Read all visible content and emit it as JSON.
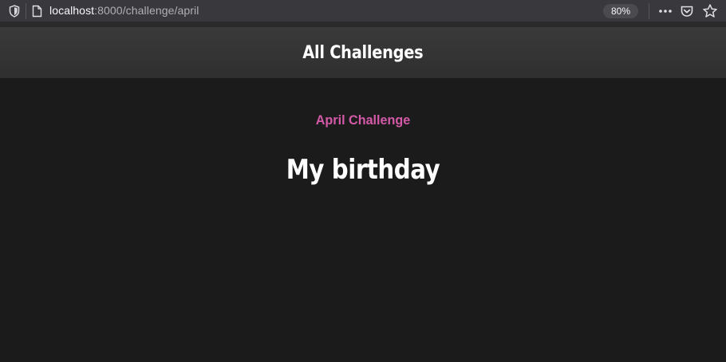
{
  "browser": {
    "url_host": "localhost",
    "url_path": ":8000/challenge/april",
    "zoom": "80%"
  },
  "header": {
    "title": "All Challenges"
  },
  "main": {
    "subtitle": "April Challenge",
    "heading": "My birthday"
  },
  "colors": {
    "background": "#1b1b1b",
    "header_bg": "#353535",
    "accent_pink": "#d45aa8",
    "text": "#ffffff"
  },
  "icons": [
    "shield-icon",
    "page-icon",
    "more-icon",
    "pocket-icon",
    "star-icon"
  ]
}
